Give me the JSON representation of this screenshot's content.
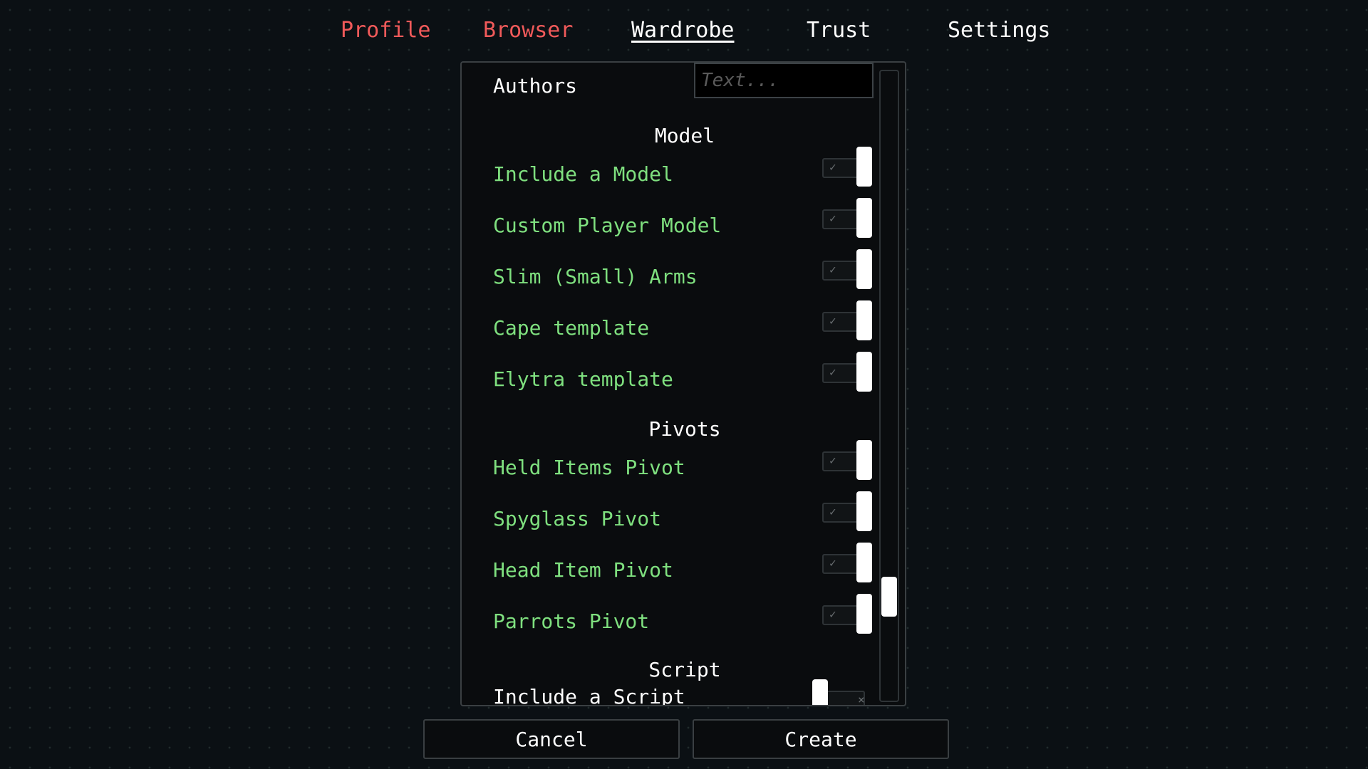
{
  "nav": {
    "tabs": [
      {
        "label": "Profile",
        "color": "#f05a5a",
        "active": false
      },
      {
        "label": "Browser",
        "color": "#f05a5a",
        "active": false
      },
      {
        "label": "Wardrobe",
        "color": "#ffffff",
        "active": true
      },
      {
        "label": "Trust",
        "color": "#ffffff",
        "active": false
      },
      {
        "label": "Settings",
        "color": "#ffffff",
        "active": false
      }
    ]
  },
  "form": {
    "authors_label": "Authors",
    "authors_placeholder": "Text...",
    "sections": {
      "model": "Model",
      "pivots": "Pivots",
      "script": "Script"
    },
    "options": [
      {
        "label": "Include a Model",
        "enabled": true
      },
      {
        "label": "Custom Player Model",
        "enabled": true
      },
      {
        "label": "Slim (Small) Arms",
        "enabled": true
      },
      {
        "label": "Cape template",
        "enabled": true
      },
      {
        "label": "Elytra template",
        "enabled": true
      },
      {
        "label": "Held Items Pivot",
        "enabled": true
      },
      {
        "label": "Spyglass Pivot",
        "enabled": true
      },
      {
        "label": "Head Item Pivot",
        "enabled": true
      },
      {
        "label": "Parrots Pivot",
        "enabled": true
      },
      {
        "label": "Include a Script",
        "enabled": false
      }
    ],
    "toggle_on_mark": "✓",
    "toggle_off_mark": "×"
  },
  "actions": {
    "cancel": "Cancel",
    "create": "Create"
  },
  "colors": {
    "accent_green": "#7fe07f",
    "tab_red": "#f05a5a",
    "background": "#0b1014"
  }
}
